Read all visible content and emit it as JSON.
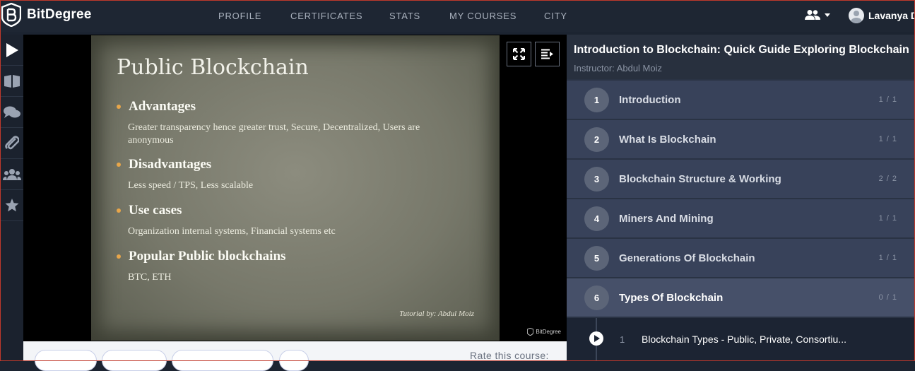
{
  "app": {
    "name": "BitDegree",
    "logo_icon": "bitdegree-shield-logo"
  },
  "nav": {
    "items": [
      "PROFILE",
      "CERTIFICATES",
      "STATS",
      "MY COURSES",
      "CITY"
    ]
  },
  "user": {
    "name": "Lavanya D",
    "menu_icon": "users-icon"
  },
  "sidebar_icons": [
    "play-icon",
    "book-icon",
    "chat-icon",
    "paperclip-icon",
    "group-icon",
    "star-icon"
  ],
  "slide": {
    "title": "Public Blockchain",
    "points": [
      {
        "heading": "Advantages",
        "text": "Greater transparency hence greater trust, Secure, Decentralized, Users are anonymous"
      },
      {
        "heading": "Disadvantages",
        "text": "Less speed / TPS, Less scalable"
      },
      {
        "heading": "Use cases",
        "text": "Organization internal systems, Financial systems etc"
      },
      {
        "heading": "Popular Public blockchains",
        "text": "BTC, ETH"
      }
    ],
    "credit": "Tutorial by: Abdul Moiz",
    "watermark": "BitDegree"
  },
  "below_video": {
    "rate_label": "Rate this course:"
  },
  "course": {
    "title": "Introduction to Blockchain: Quick Guide Exploring Blockchain",
    "instructor": "Instructor: Abdul Moiz",
    "chapters": [
      {
        "num": "1",
        "title": "Introduction",
        "progress": "1 / 1"
      },
      {
        "num": "2",
        "title": "What Is Blockchain",
        "progress": "1 / 1"
      },
      {
        "num": "3",
        "title": "Blockchain Structure & Working",
        "progress": "2 / 2"
      },
      {
        "num": "4",
        "title": "Miners And Mining",
        "progress": "1 / 1"
      },
      {
        "num": "5",
        "title": "Generations Of Blockchain",
        "progress": "1 / 1"
      },
      {
        "num": "6",
        "title": "Types Of Blockchain",
        "progress": "0 / 1"
      }
    ],
    "active_lesson": {
      "num": "1",
      "title": "Blockchain Types - Public, Private, Consortiu..."
    }
  },
  "colors": {
    "accent_bullet": "#e8a64a",
    "panel": "#2a3344",
    "topbar": "#1e2633"
  }
}
